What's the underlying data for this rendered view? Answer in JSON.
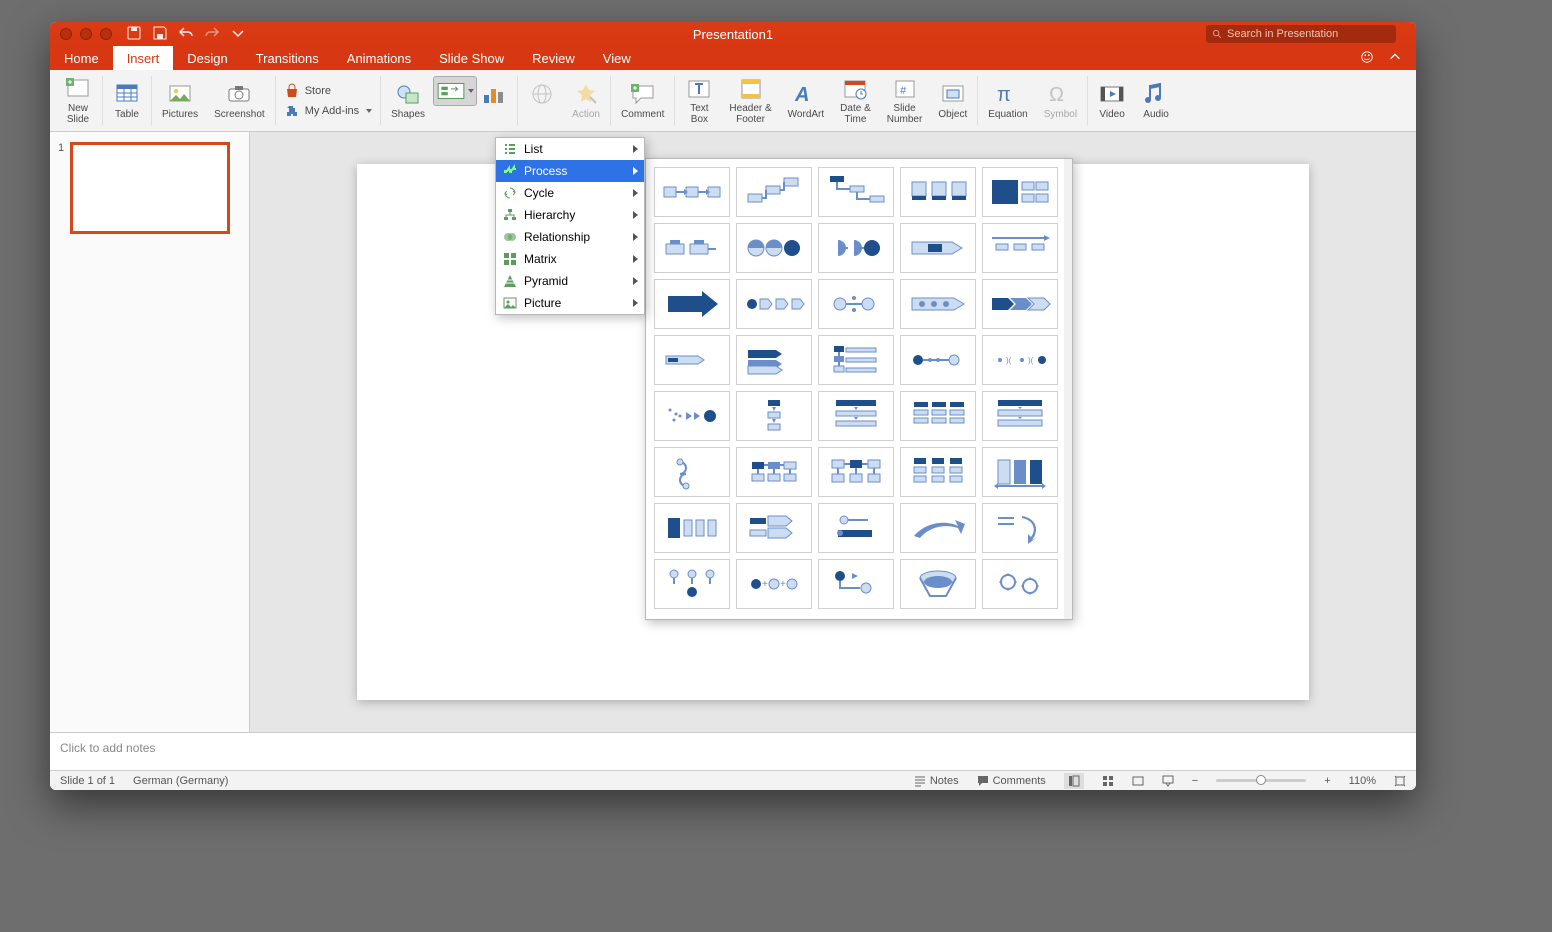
{
  "window": {
    "title": "Presentation1",
    "search_placeholder": "Search in Presentation"
  },
  "tabs": [
    "Home",
    "Insert",
    "Design",
    "Transitions",
    "Animations",
    "Slide Show",
    "Review",
    "View"
  ],
  "active_tab": "Insert",
  "ribbon": {
    "newslide": "New\nSlide",
    "table": "Table",
    "pictures": "Pictures",
    "screenshot": "Screenshot",
    "store": "Store",
    "myaddins": "My Add-ins",
    "shapes": "Shapes",
    "action": "Action",
    "comment": "Comment",
    "textbox": "Text\nBox",
    "headerfooter": "Header &\nFooter",
    "wordart": "WordArt",
    "datetime": "Date &\nTime",
    "slidenumber": "Slide\nNumber",
    "object": "Object",
    "equation": "Equation",
    "symbol": "Symbol",
    "video": "Video",
    "audio": "Audio"
  },
  "smartart_menu": [
    "List",
    "Process",
    "Cycle",
    "Hierarchy",
    "Relationship",
    "Matrix",
    "Pyramid",
    "Picture"
  ],
  "smartart_selected": "Process",
  "thumbnail_number": "1",
  "notes_placeholder": "Click to add notes",
  "status": {
    "slide": "Slide 1 of 1",
    "lang": "German (Germany)",
    "notes": "Notes",
    "comments": "Comments",
    "zoom": "110%"
  }
}
